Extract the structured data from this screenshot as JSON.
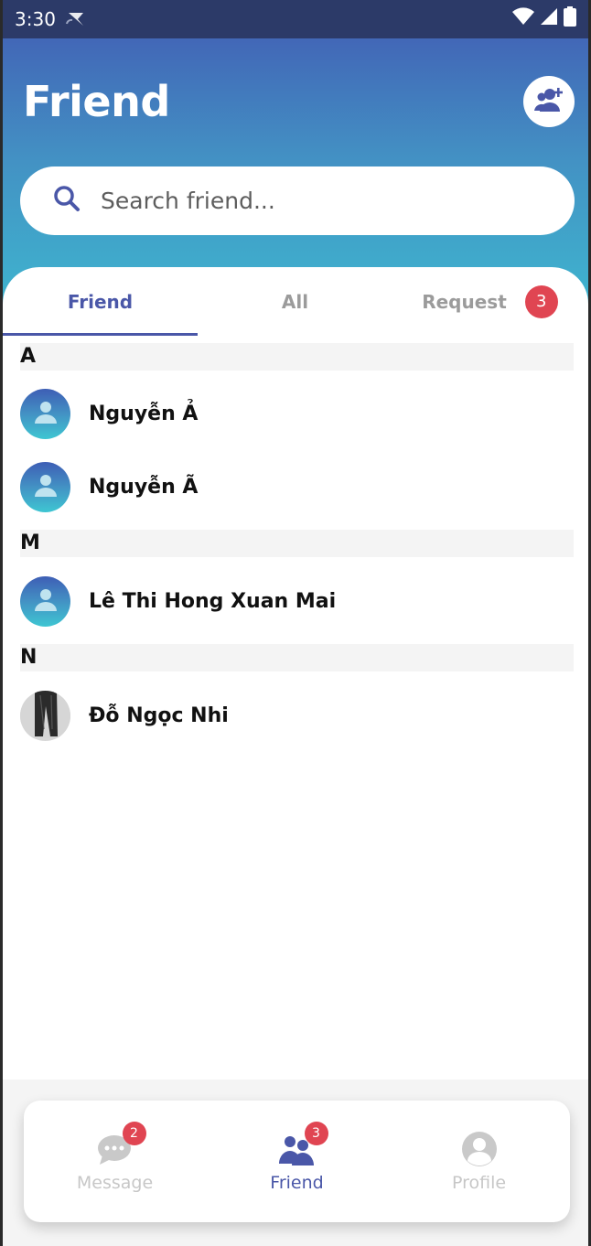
{
  "status_bar": {
    "time": "3:30"
  },
  "header": {
    "title": "Friend",
    "add_friend_icon": "person-add-icon"
  },
  "search": {
    "placeholder": "Search friend...",
    "value": "",
    "icon": "search-icon"
  },
  "tabs": [
    {
      "label": "Friend",
      "active": true
    },
    {
      "label": "All",
      "active": false
    },
    {
      "label": "Request",
      "active": false,
      "badge": "3"
    }
  ],
  "sections": [
    {
      "letter": "A",
      "friends": [
        {
          "name": "Nguyễn Ả",
          "avatar": "default"
        },
        {
          "name": "Nguyễn Ã",
          "avatar": "default"
        }
      ]
    },
    {
      "letter": "M",
      "friends": [
        {
          "name": "Lê Thi Hong Xuan Mai",
          "avatar": "default"
        }
      ]
    },
    {
      "letter": "N",
      "friends": [
        {
          "name": "Đỗ Ngọc Nhi",
          "avatar": "photo"
        }
      ]
    }
  ],
  "bottom_nav": [
    {
      "label": "Message",
      "badge": "2",
      "icon": "chat-bubble-icon",
      "active": false
    },
    {
      "label": "Friend",
      "badge": "3",
      "icon": "people-icon",
      "active": true
    },
    {
      "label": "Profile",
      "icon": "profile-icon",
      "active": false
    }
  ],
  "colors": {
    "accent": "#4a57a8",
    "badge": "#e04552",
    "header_top": "#4267b7",
    "header_bottom": "#3eb6cf"
  }
}
